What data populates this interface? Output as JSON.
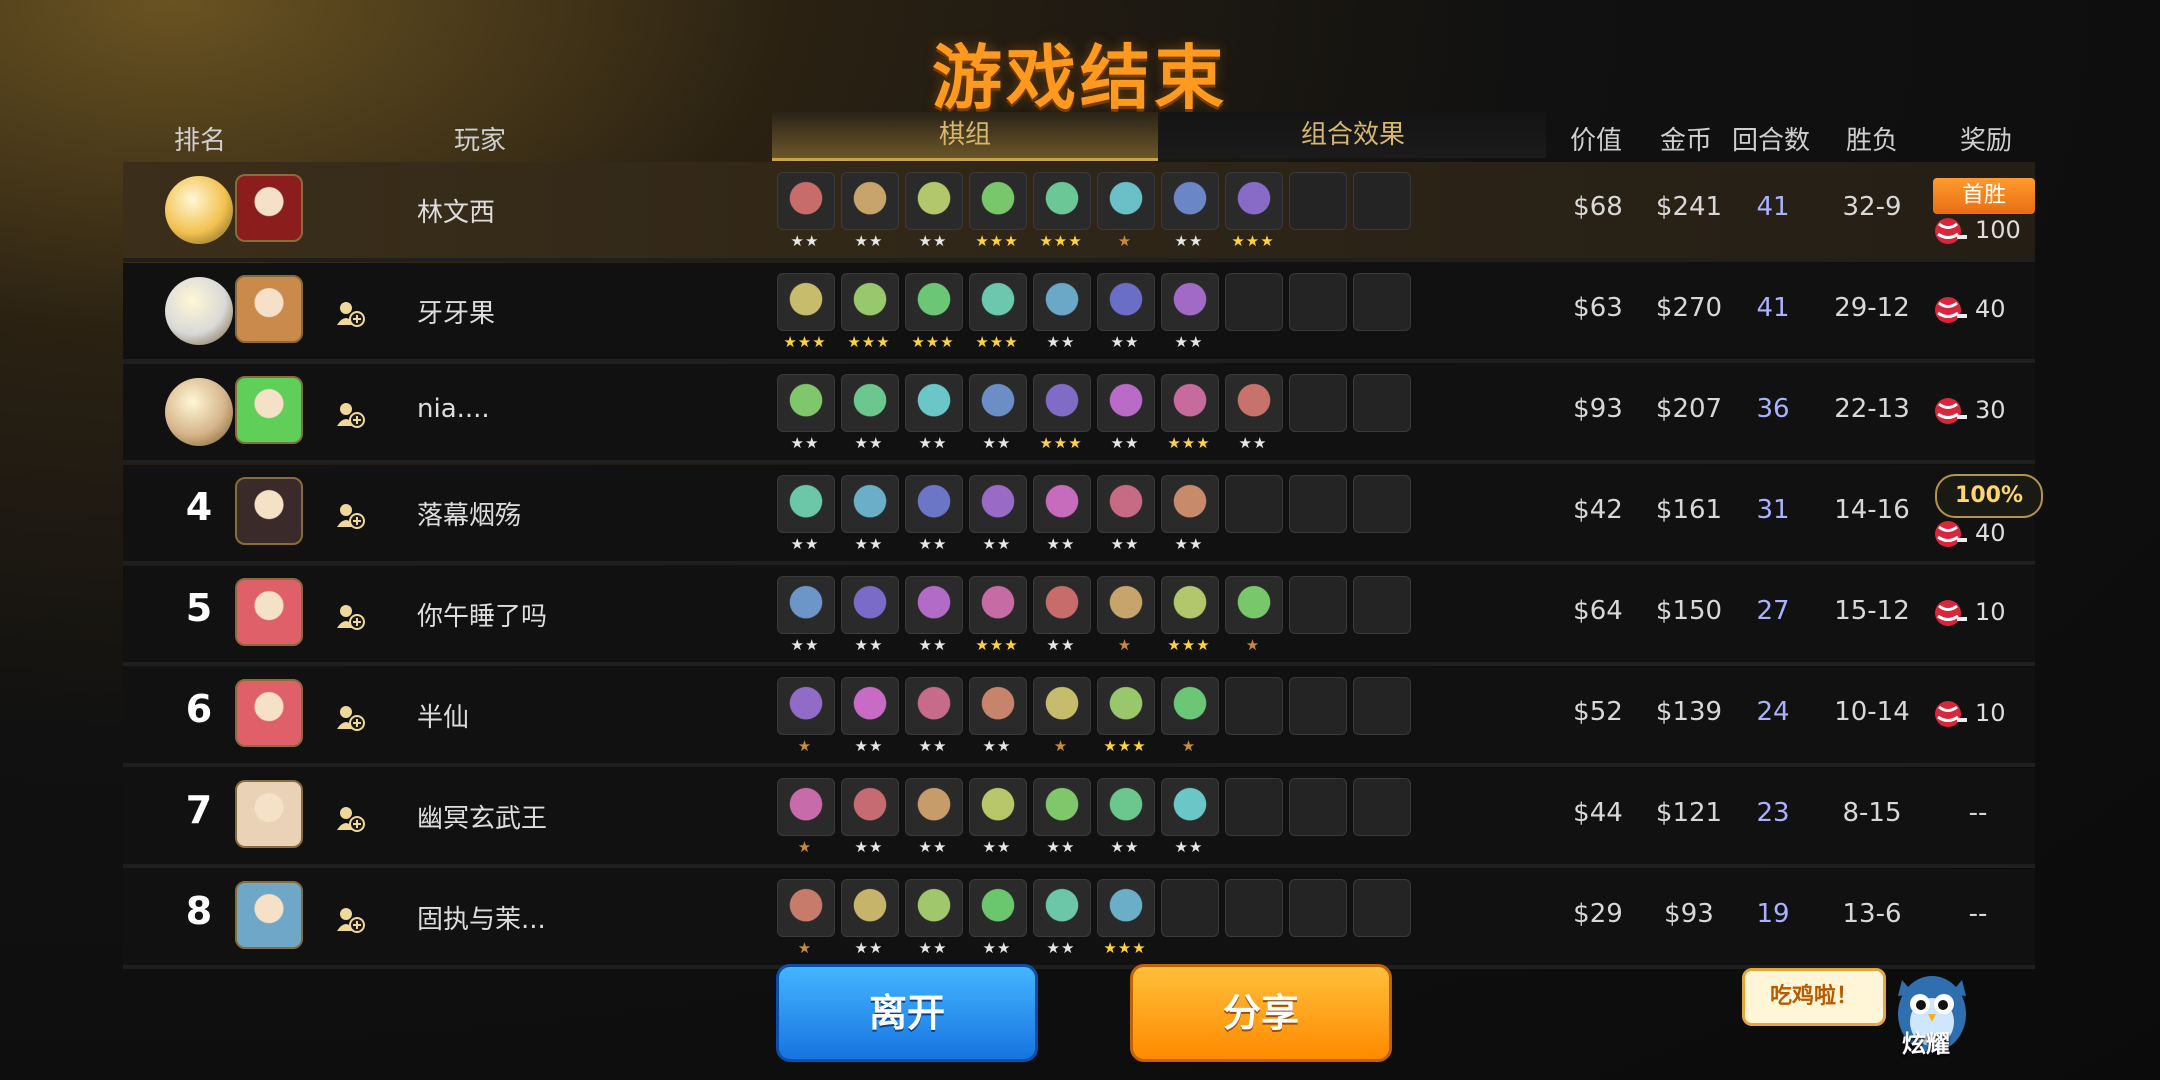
{
  "title": "游戏结束",
  "headers": {
    "rank": "排名",
    "player": "玩家",
    "tab_board": "棋组",
    "tab_synergy": "组合效果",
    "value": "价值",
    "gold": "金币",
    "rounds": "回合数",
    "winloss": "胜负",
    "reward": "奖励"
  },
  "players": [
    {
      "rank": "",
      "name": "林文西",
      "value": "$68",
      "gold": "$241",
      "rounds": "41",
      "wl": "32-9",
      "reward": "100",
      "units": [
        {
          "s": "★★",
          "c": "w"
        },
        {
          "s": "★★",
          "c": "w"
        },
        {
          "s": "★★",
          "c": "w"
        },
        {
          "s": "★★★",
          "c": "g"
        },
        {
          "s": "★★★",
          "c": "g"
        },
        {
          "s": "★",
          "c": "b"
        },
        {
          "s": "★★",
          "c": "w"
        },
        {
          "s": "★★★",
          "c": "g"
        }
      ]
    },
    {
      "rank": "",
      "name": "牙牙果",
      "value": "$63",
      "gold": "$270",
      "rounds": "41",
      "wl": "29-12",
      "reward": "40",
      "units": [
        {
          "s": "★★★",
          "c": "g"
        },
        {
          "s": "★★★",
          "c": "g"
        },
        {
          "s": "★★★",
          "c": "g"
        },
        {
          "s": "★★★",
          "c": "g"
        },
        {
          "s": "★★",
          "c": "w"
        },
        {
          "s": "★★",
          "c": "w"
        },
        {
          "s": "★★",
          "c": "w"
        }
      ]
    },
    {
      "rank": "",
      "name": "nia....",
      "value": "$93",
      "gold": "$207",
      "rounds": "36",
      "wl": "22-13",
      "reward": "30",
      "units": [
        {
          "s": "★★",
          "c": "w"
        },
        {
          "s": "★★",
          "c": "w"
        },
        {
          "s": "★★",
          "c": "w"
        },
        {
          "s": "★★",
          "c": "w"
        },
        {
          "s": "★★★",
          "c": "g"
        },
        {
          "s": "★★",
          "c": "w"
        },
        {
          "s": "★★★",
          "c": "g"
        },
        {
          "s": "★★",
          "c": "w"
        }
      ]
    },
    {
      "rank": "4",
      "name": "落幕烟殇",
      "value": "$42",
      "gold": "$161",
      "rounds": "31",
      "wl": "14-16",
      "reward": "40",
      "pct": "100%",
      "units": [
        {
          "s": "★★",
          "c": "w"
        },
        {
          "s": "★★",
          "c": "w"
        },
        {
          "s": "★★",
          "c": "w"
        },
        {
          "s": "★★",
          "c": "w"
        },
        {
          "s": "★★",
          "c": "w"
        },
        {
          "s": "★★",
          "c": "w"
        },
        {
          "s": "★★",
          "c": "w"
        }
      ]
    },
    {
      "rank": "5",
      "name": "你午睡了吗",
      "value": "$64",
      "gold": "$150",
      "rounds": "27",
      "wl": "15-12",
      "reward": "10",
      "units": [
        {
          "s": "★★",
          "c": "w"
        },
        {
          "s": "★★",
          "c": "w"
        },
        {
          "s": "★★",
          "c": "w"
        },
        {
          "s": "★★★",
          "c": "g"
        },
        {
          "s": "★★",
          "c": "w"
        },
        {
          "s": "★",
          "c": "b"
        },
        {
          "s": "★★★",
          "c": "g"
        },
        {
          "s": "★",
          "c": "b"
        }
      ]
    },
    {
      "rank": "6",
      "name": "半仙",
      "value": "$52",
      "gold": "$139",
      "rounds": "24",
      "wl": "10-14",
      "reward": "10",
      "units": [
        {
          "s": "★",
          "c": "b"
        },
        {
          "s": "★★",
          "c": "w"
        },
        {
          "s": "★★",
          "c": "w"
        },
        {
          "s": "★★",
          "c": "w"
        },
        {
          "s": "★",
          "c": "b"
        },
        {
          "s": "★★★",
          "c": "g"
        },
        {
          "s": "★",
          "c": "b"
        }
      ]
    },
    {
      "rank": "7",
      "name": "幽冥玄武王",
      "value": "$44",
      "gold": "$121",
      "rounds": "23",
      "wl": "8-15",
      "reward": "--",
      "units": [
        {
          "s": "★",
          "c": "b"
        },
        {
          "s": "★★",
          "c": "w"
        },
        {
          "s": "★★",
          "c": "w"
        },
        {
          "s": "★★",
          "c": "w"
        },
        {
          "s": "★★",
          "c": "w"
        },
        {
          "s": "★★",
          "c": "w"
        },
        {
          "s": "★★",
          "c": "w"
        }
      ]
    },
    {
      "rank": "8",
      "name": "固执与茉...",
      "value": "$29",
      "gold": "$93",
      "rounds": "19",
      "wl": "13-6",
      "reward": "--",
      "units": [
        {
          "s": "★",
          "c": "b"
        },
        {
          "s": "★★",
          "c": "w"
        },
        {
          "s": "★★",
          "c": "w"
        },
        {
          "s": "★★",
          "c": "w"
        },
        {
          "s": "★★",
          "c": "w"
        },
        {
          "s": "★★★",
          "c": "g"
        }
      ]
    }
  ],
  "first_win_label": "首胜",
  "buttons": {
    "leave": "离开",
    "share": "分享"
  },
  "bubble": "吃鸡啦！",
  "flaunt": "炫耀",
  "colors": {
    "accent": "#ff9a1f",
    "rounds": "#a9b2ff",
    "star_gold": "#ffd23f",
    "star_white": "#e6e6e6",
    "star_bronze": "#c88a3c"
  }
}
